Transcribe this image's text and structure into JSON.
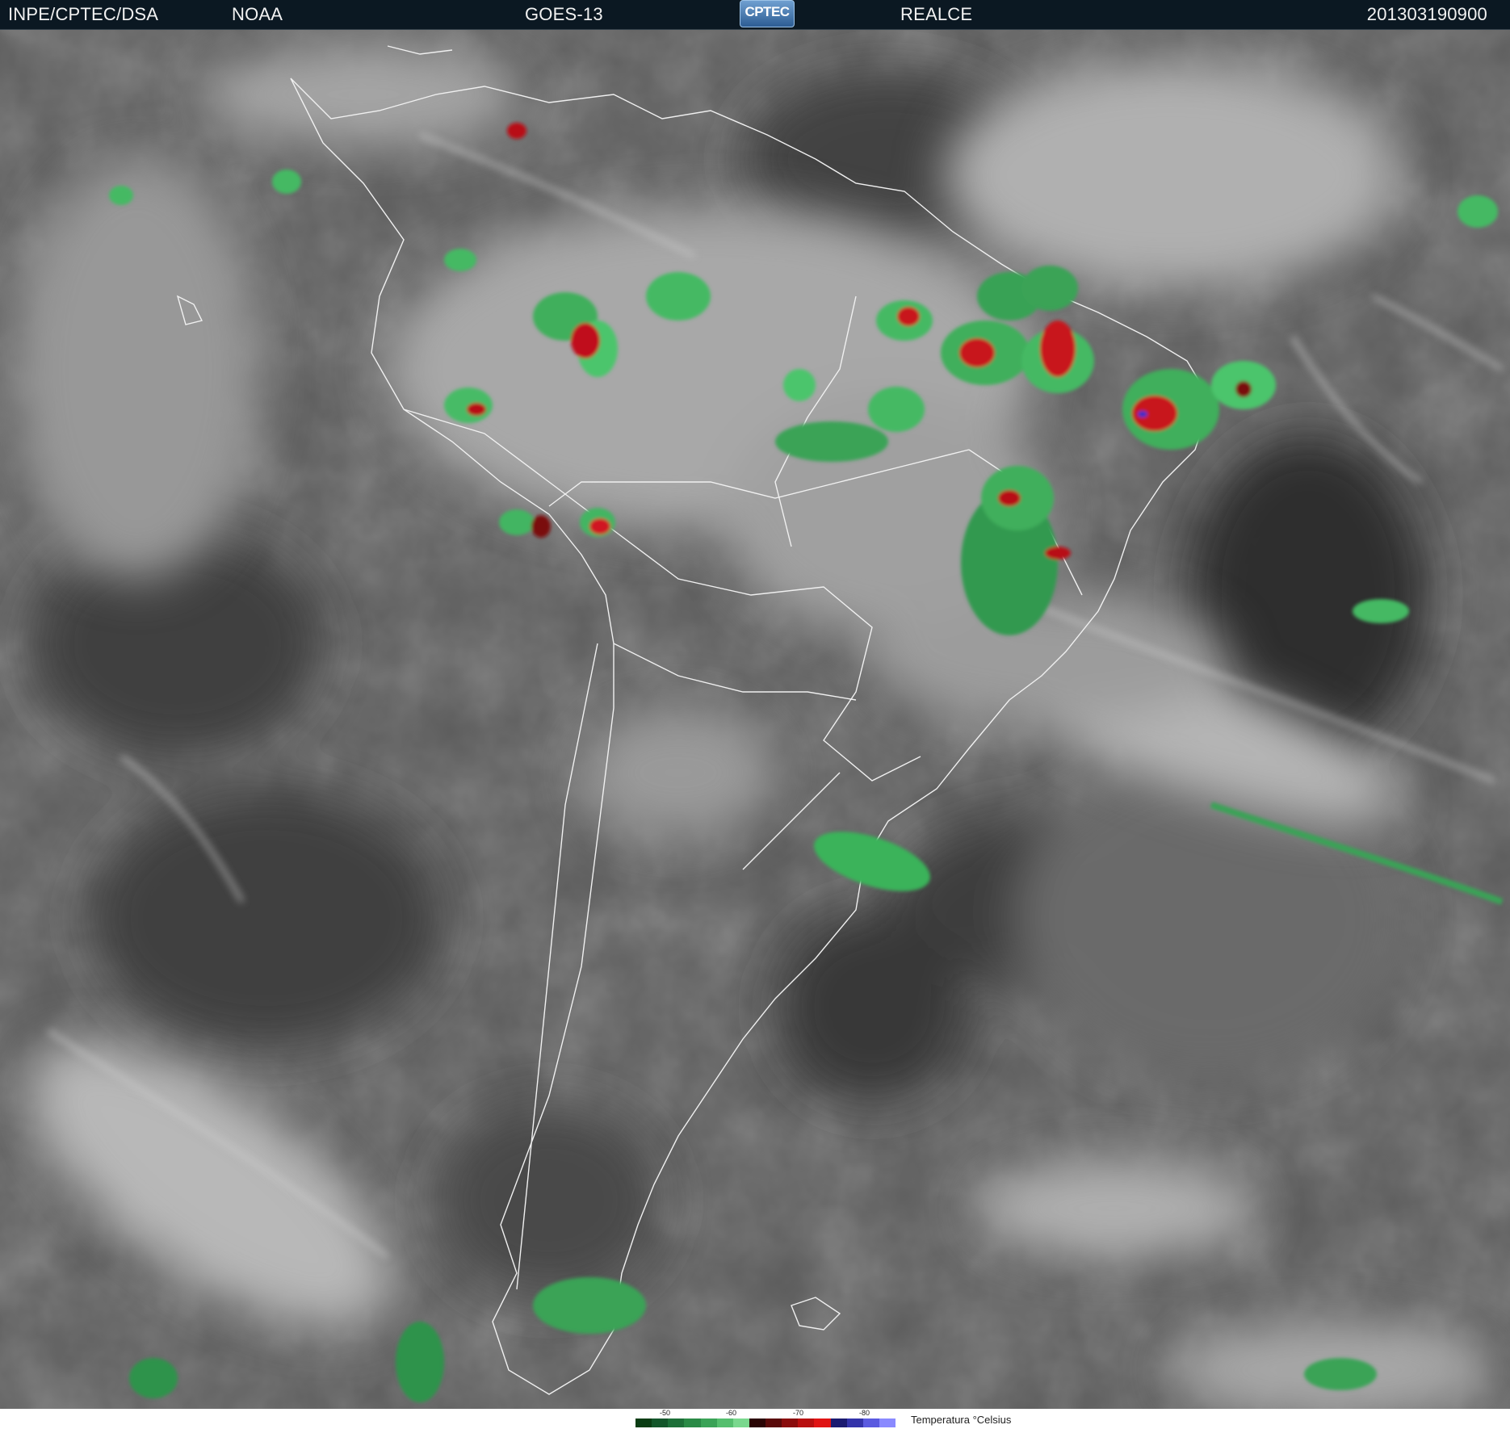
{
  "header": {
    "agency": "INPE/CPTEC/DSA",
    "noaa": "NOAA",
    "satellite": "GOES-13",
    "logo": "CPTEC",
    "enhancement": "REALCE",
    "timestamp": "201303190900"
  },
  "scale": {
    "title": "Temperatura  °Celsius",
    "tick_labels": [
      "-50",
      "-60",
      "-70",
      "-80"
    ],
    "colors": [
      "#0a3d14",
      "#13562a",
      "#1d6f38",
      "#2a8a46",
      "#3aa357",
      "#55bf6e",
      "#7ad88e",
      "#2a0505",
      "#5a0a0a",
      "#8a0d0d",
      "#b81010",
      "#e01414",
      "#1a1a70",
      "#3333aa",
      "#5a5ae0",
      "#8a8aff"
    ]
  }
}
